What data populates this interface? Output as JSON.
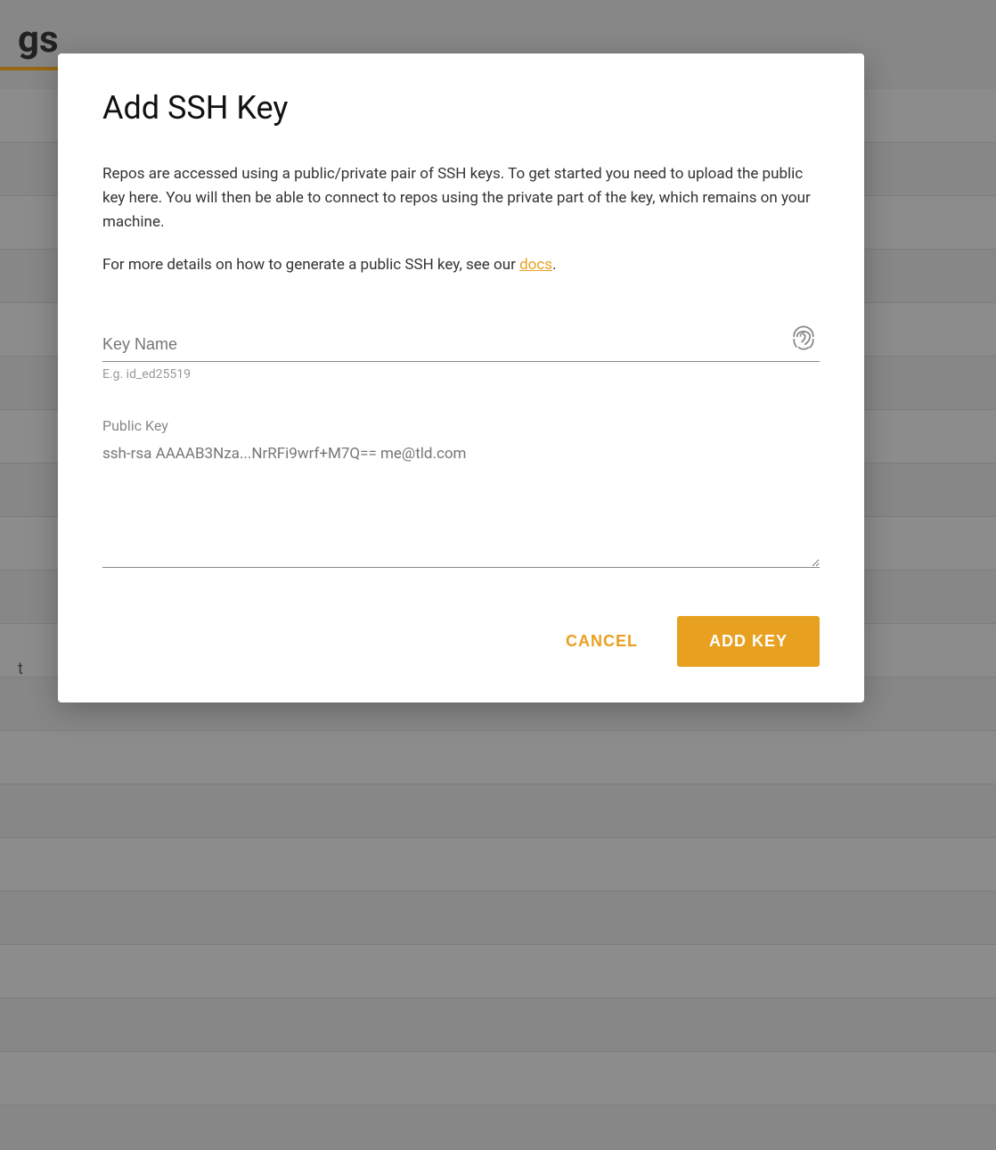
{
  "background": {
    "title": "gs",
    "accent_color": "#e8a020",
    "side_text": "t"
  },
  "modal": {
    "title": "Add SSH Key",
    "description_1": "Repos are accessed using a public/private pair of SSH keys. To get started you need to upload the public key here. You will then be able to connect to repos using the private part of the key, which remains on your machine.",
    "description_2_prefix": "For more details on how to generate a public SSH key, see our ",
    "docs_link_text": "docs",
    "description_2_suffix": ".",
    "key_name_label": "Key Name",
    "key_name_placeholder": "Key Name",
    "key_name_hint": "E.g. id_ed25519",
    "public_key_label": "Public Key",
    "public_key_placeholder": "ssh-rsa AAAAB3Nza...NrRFi9wrf+M7Q== me@tld.com",
    "cancel_label": "CANCEL",
    "add_key_label": "ADD KEY",
    "fingerprint_icon": "fingerprint-icon"
  }
}
